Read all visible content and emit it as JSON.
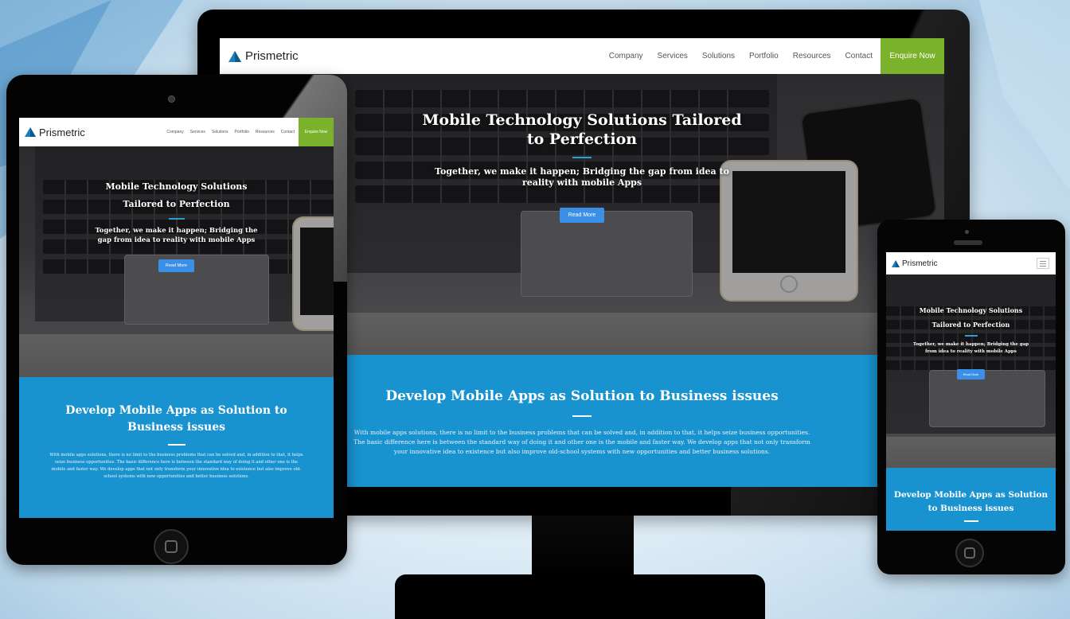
{
  "brand": {
    "name": "Prismetric",
    "logo_color": "#1a7fb8",
    "accent_green": "#7bb22c",
    "accent_blue": "#1993cf",
    "button_blue": "#3b8fe6"
  },
  "nav": {
    "items": [
      "Company",
      "Services",
      "Solutions",
      "Portfolio",
      "Resources",
      "Contact"
    ],
    "cta": "Enquire Now",
    "menu_icon": "hamburger-menu-icon"
  },
  "hero": {
    "title": "Mobile Technology Solutions Tailored to Perfection",
    "subtitle": "Together, we make it happen; Bridging the gap from idea to reality with mobile Apps",
    "button": "Read More"
  },
  "section": {
    "title": "Develop Mobile Apps as Solution to Business issues",
    "body": "With mobile apps solutions, there is no limit to the business problems that can be solved and, in addition to that, it helps seize business opportunities. The basic difference here is between the standard way of doing it and other one is the mobile and faster way. We develop apps that not only transform your innovative idea to existence but also improve old-school systems with new opportunities and better business solutions."
  },
  "devices": {
    "icons": [
      "monitor-icon",
      "tablet-icon",
      "phone-icon"
    ]
  }
}
